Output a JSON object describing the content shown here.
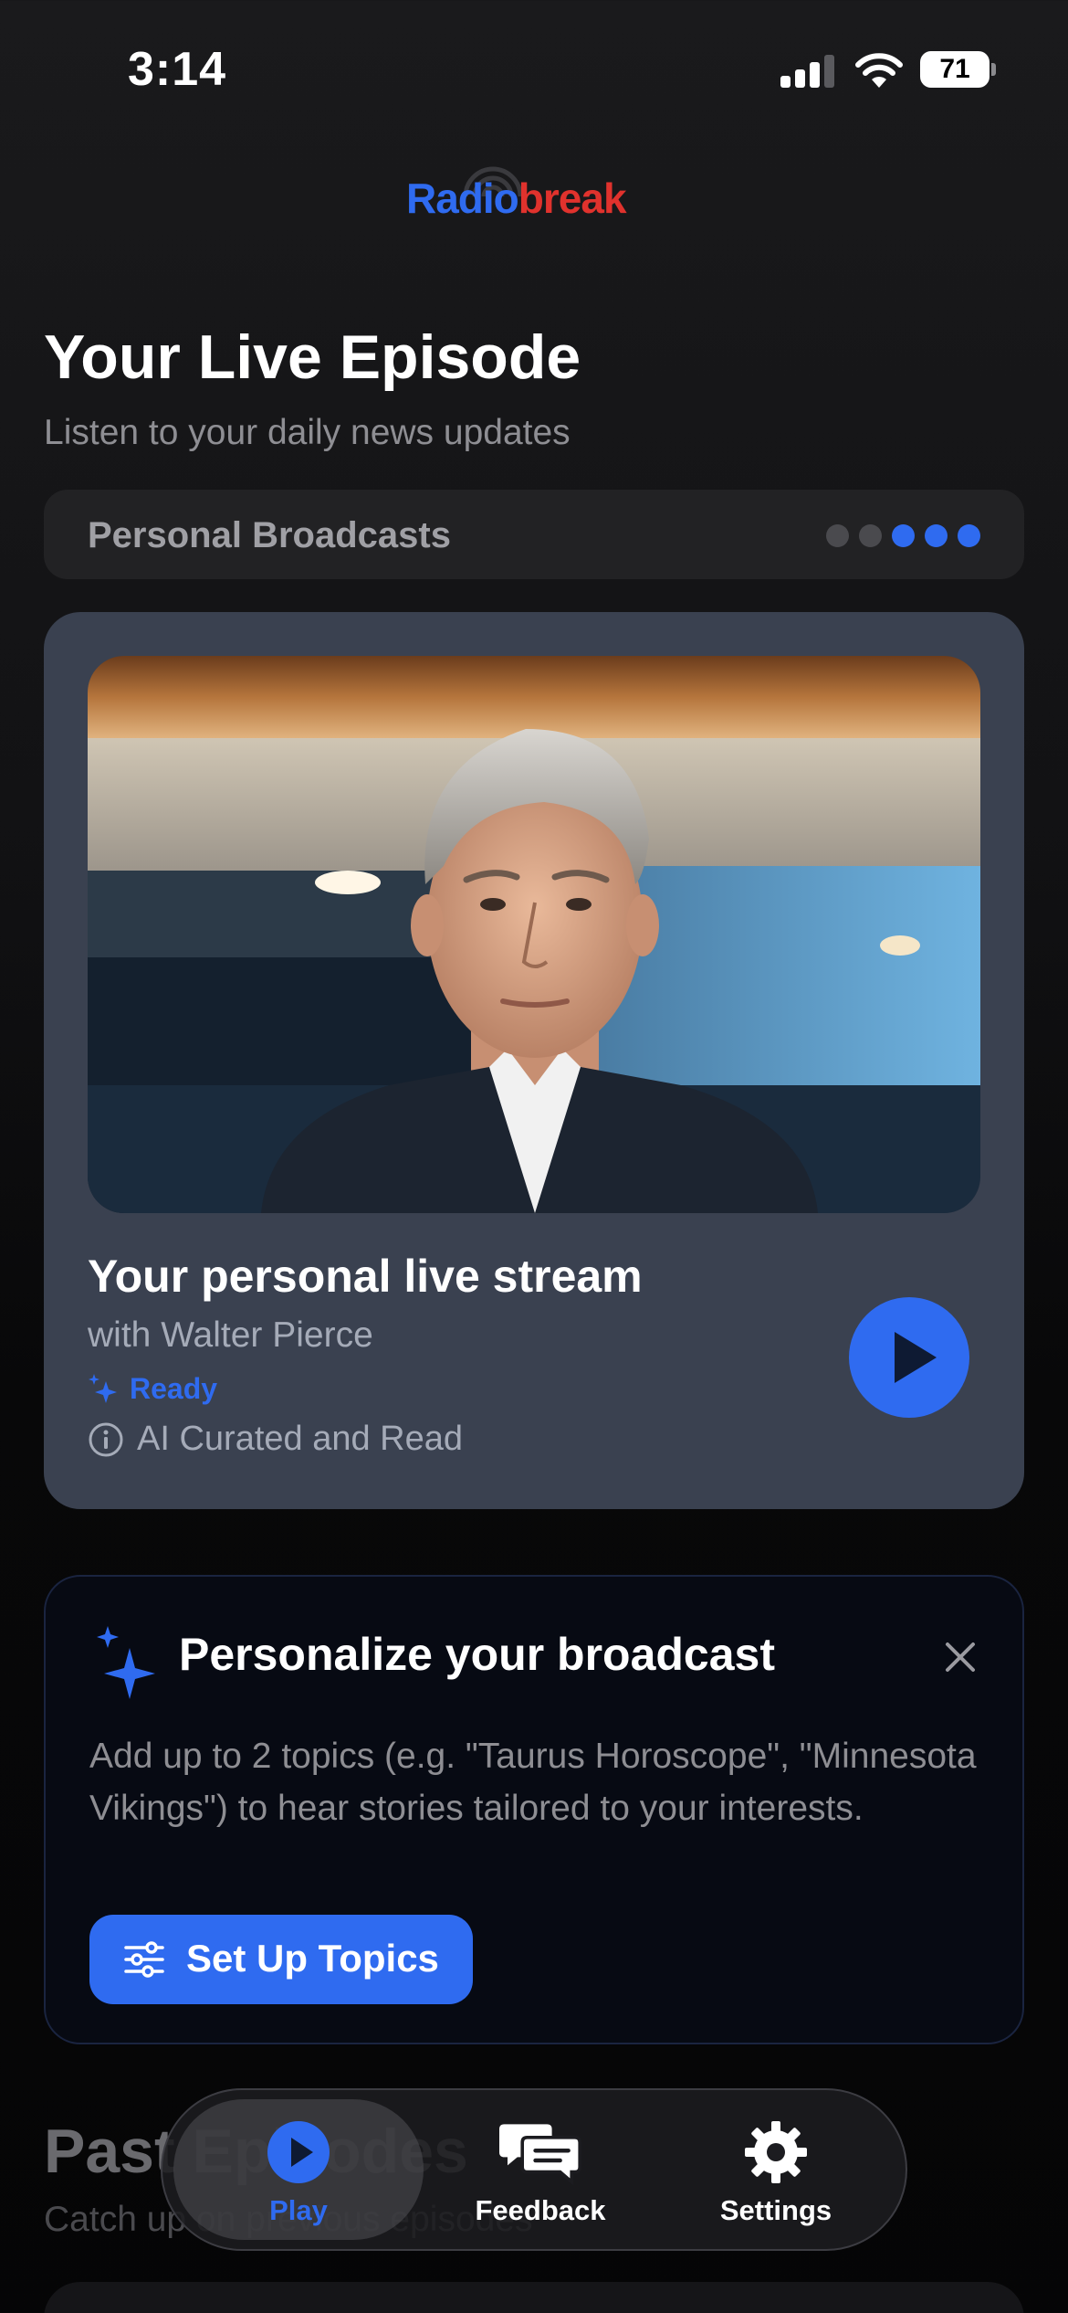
{
  "status_bar": {
    "time": "3:14",
    "battery": "71"
  },
  "logo": {
    "part1": "Radio",
    "part2": "break"
  },
  "header": {
    "title": "Your Live Episode",
    "subtitle": "Listen to your daily news updates"
  },
  "broadcast_selector": {
    "label": "Personal Broadcasts",
    "page_count": 5,
    "active_from": 2
  },
  "episode": {
    "title": "Your personal live stream",
    "host": "with Walter Pierce",
    "status": "Ready",
    "info": "AI Curated and Read"
  },
  "personalize": {
    "title": "Personalize your broadcast",
    "description": "Add up to 2 topics (e.g. \"Taurus Horoscope\", \"Minnesota Vikings\") to hear stories tailored to your interests.",
    "button_label": "Set Up Topics"
  },
  "past_episodes": {
    "title": "Past Episodes",
    "subtitle": "Catch up on previous episodes"
  },
  "tabbar": {
    "tabs": [
      {
        "label": "Play",
        "icon": "play-circle-icon",
        "active": true
      },
      {
        "label": "Feedback",
        "icon": "chat-bubbles-icon",
        "active": false
      },
      {
        "label": "Settings",
        "icon": "gear-icon",
        "active": false
      }
    ]
  },
  "colors": {
    "accent": "#2f6bf0",
    "brand_red": "#e0322d",
    "card_bg": "#3a4150",
    "background": "#121214",
    "muted_text": "#8e8e93"
  }
}
